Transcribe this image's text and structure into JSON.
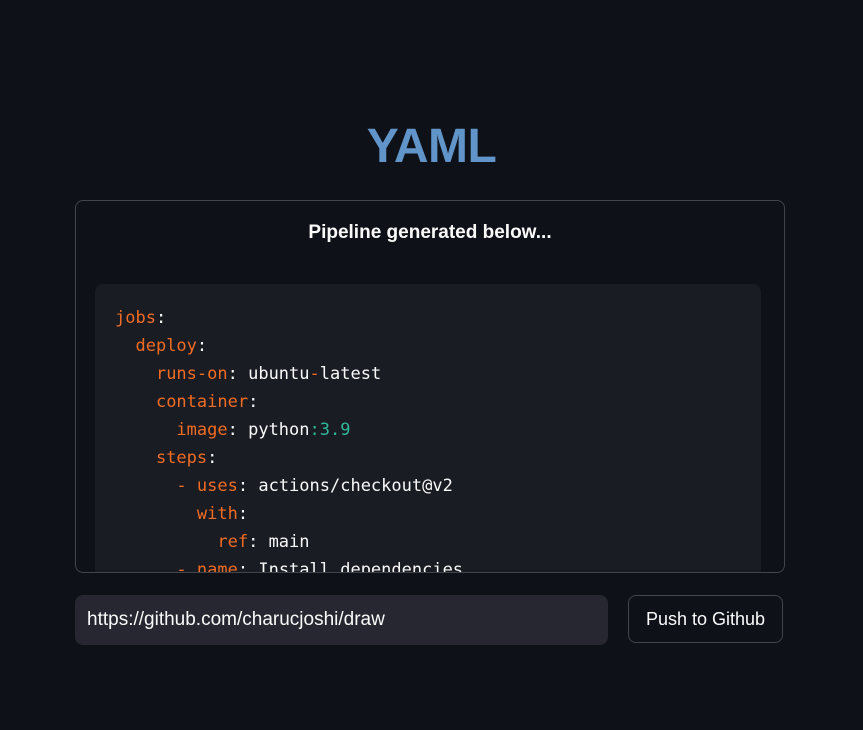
{
  "header": {
    "title": "YAML"
  },
  "pipeline_card": {
    "heading": "Pipeline generated below...",
    "code_lines": [
      [
        {
          "t": "jobs",
          "c": "k"
        },
        {
          "t": ":",
          "c": "p"
        }
      ],
      [
        {
          "t": "  "
        },
        {
          "t": "deploy",
          "c": "k"
        },
        {
          "t": ":",
          "c": "p"
        }
      ],
      [
        {
          "t": "    "
        },
        {
          "t": "runs-on",
          "c": "k"
        },
        {
          "t": ": ",
          "c": "p"
        },
        {
          "t": "ubuntu",
          "c": "v"
        },
        {
          "t": "-",
          "c": "d"
        },
        {
          "t": "latest",
          "c": "v"
        }
      ],
      [
        {
          "t": "    "
        },
        {
          "t": "container",
          "c": "k"
        },
        {
          "t": ":",
          "c": "p"
        }
      ],
      [
        {
          "t": "      "
        },
        {
          "t": "image",
          "c": "k"
        },
        {
          "t": ": ",
          "c": "p"
        },
        {
          "t": "python",
          "c": "v"
        },
        {
          "t": ":3.9",
          "c": "n"
        }
      ],
      [
        {
          "t": "    "
        },
        {
          "t": "steps",
          "c": "k"
        },
        {
          "t": ":",
          "c": "p"
        }
      ],
      [
        {
          "t": "      "
        },
        {
          "t": "- ",
          "c": "d"
        },
        {
          "t": "uses",
          "c": "k"
        },
        {
          "t": ": ",
          "c": "p"
        },
        {
          "t": "actions/checkout@v2",
          "c": "v"
        }
      ],
      [
        {
          "t": "        "
        },
        {
          "t": "with",
          "c": "k"
        },
        {
          "t": ":",
          "c": "p"
        }
      ],
      [
        {
          "t": "          "
        },
        {
          "t": "ref",
          "c": "k"
        },
        {
          "t": ": ",
          "c": "p"
        },
        {
          "t": "main",
          "c": "v"
        }
      ],
      [
        {
          "t": "      "
        },
        {
          "t": "- ",
          "c": "d"
        },
        {
          "t": "name",
          "c": "k"
        },
        {
          "t": ": ",
          "c": "p"
        },
        {
          "t": "Install dependencies",
          "c": "v"
        }
      ]
    ]
  },
  "repo_form": {
    "url_value": "https://github.com/charucjoshi/draw",
    "push_label": "Push to Github"
  },
  "colors": {
    "background": "#0e1117",
    "title": "#6194c8",
    "code_background": "#1a1c23",
    "yaml_key": "#f26b22",
    "yaml_number": "#2eb89a",
    "input_background": "#262730"
  }
}
